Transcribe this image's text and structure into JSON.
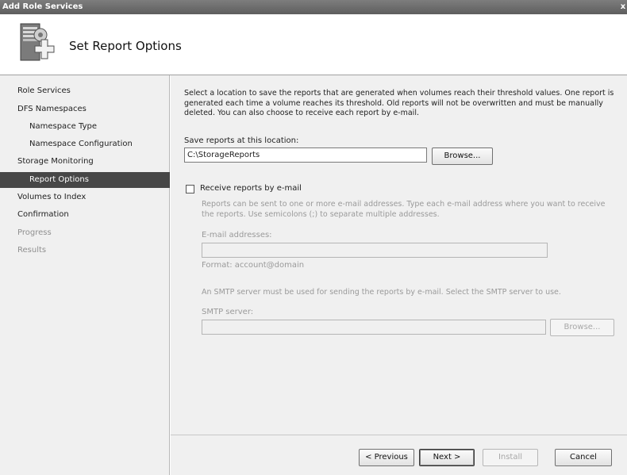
{
  "window": {
    "title": "Add Role Services",
    "close_glyph": "x"
  },
  "header": {
    "title": "Set Report Options",
    "icon": "server-wizard-icon"
  },
  "nav": {
    "items": [
      {
        "label": "Role Services"
      },
      {
        "label": "DFS Namespaces"
      },
      {
        "label": "Namespace Type"
      },
      {
        "label": "Namespace Configuration"
      },
      {
        "label": "Storage Monitoring"
      },
      {
        "label": "Report Options"
      },
      {
        "label": "Volumes to Index"
      },
      {
        "label": "Confirmation"
      },
      {
        "label": "Progress"
      },
      {
        "label": "Results"
      }
    ]
  },
  "main": {
    "description": "Select a location to save the reports that are generated when volumes reach their threshold values. One report is generated each time a volume reaches its threshold. Old reports will not be overwritten and must be manually deleted. You can also choose to receive each report by e-mail.",
    "save_label": "Save reports at this location:",
    "save_path": "C:\\StorageReports",
    "browse_label": "Browse...",
    "email": {
      "checkbox_label": "Receive reports by e-mail",
      "checked": false,
      "help": "Reports can be sent to one or more e-mail addresses. Type each e-mail address where you want to receive the reports. Use semicolons (;) to separate multiple addresses.",
      "addresses_label": "E-mail addresses:",
      "addresses_value": "",
      "format_hint": "Format: account@domain",
      "smtp_help": "An SMTP server must be used for sending the reports by e-mail. Select the SMTP server to use.",
      "smtp_label": "SMTP server:",
      "smtp_value": "",
      "smtp_browse_label": "Browse..."
    }
  },
  "footer": {
    "previous_label": "< Previous",
    "next_label": "Next >",
    "install_label": "Install",
    "cancel_label": "Cancel"
  }
}
